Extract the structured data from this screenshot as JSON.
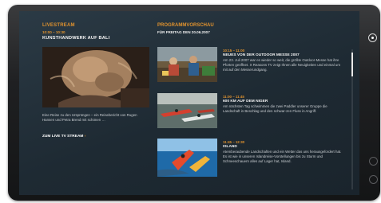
{
  "livestream": {
    "heading": "LIVESTREAM",
    "time": "10:00 – 10:30",
    "title": "KUNSTHANDWERK AUF BALI",
    "description": "Eine Reise zu den Ursprüngen – ein Reisebericht von Rugen Hansen und Petra Brend mit schönen …",
    "link_label": "ZUM LIVE TV STREAM",
    "link_arrow": "›"
  },
  "programm": {
    "heading": "PROGRAMMVORSCHAU",
    "date": "FÜR FREITAG DEN 20.06.2007",
    "items": [
      {
        "time": "10:15 – 11:00",
        "title": "NEUES VON DER OUTDOOR MESSE 2007",
        "text": "Am 23. Juli 2007 war es wieder so weit, die größte Outdoor-Messe hat ihre Pforten geöffnet. X Reasons TV zeigt Ihnen alle Neuigkeiten und einmal um mit auf den Messerundgang."
      },
      {
        "time": "11:00 – 11:45",
        "title": "600 KM AUF DEM NIGER",
        "text": "Am nächsten Tag schwimmen die zwei Paddler unserer Gruppe die Landschaft in Beschlag und den schwar-zen Fluss in Angriff."
      },
      {
        "time": "11:45 – 12:30",
        "title": "ISLAND",
        "text": "Atemberaubende Landschaften und ein Wetter das uns herausgefordert hat. Es ist wie in unseren Islandreise-Vorstellungen bis zu Sturm und Schneeschauern alles auf Lager hat, Island."
      }
    ]
  },
  "colors": {
    "accent": "#e0922e",
    "screen": "#1e2a33",
    "bezel": "#1f2022"
  }
}
